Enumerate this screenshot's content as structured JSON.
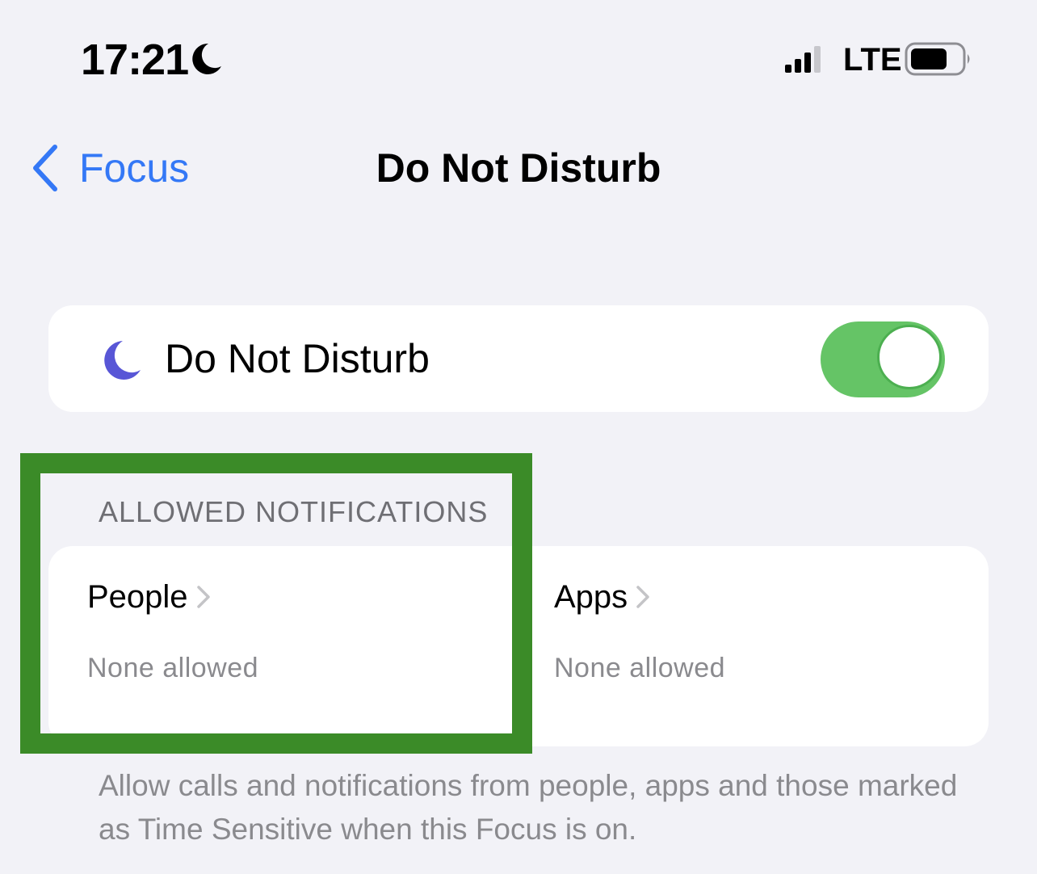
{
  "status_bar": {
    "time": "17:21",
    "focus_icon": "moon-icon",
    "network": "LTE",
    "signal_icon": "cellular-signal-icon",
    "battery_icon": "battery-icon"
  },
  "nav": {
    "back_label": "Focus",
    "back_icon": "chevron-left-icon",
    "title": "Do Not Disturb"
  },
  "focus_toggle": {
    "icon": "moon-icon",
    "label": "Do Not Disturb",
    "enabled": true
  },
  "allowed_notifications": {
    "header": "ALLOWED NOTIFICATIONS",
    "cells": [
      {
        "title": "People",
        "subtitle": "None allowed"
      },
      {
        "title": "Apps",
        "subtitle": "None allowed"
      }
    ],
    "footer": "Allow calls and notifications from people, apps and those marked as Time Sensitive when this Focus is on."
  },
  "colors": {
    "background": "#f2f2f7",
    "accent": "#3478f6",
    "switch_on": "#65c466",
    "moon_purple": "#5856d6",
    "highlight": "#3b8b28"
  }
}
